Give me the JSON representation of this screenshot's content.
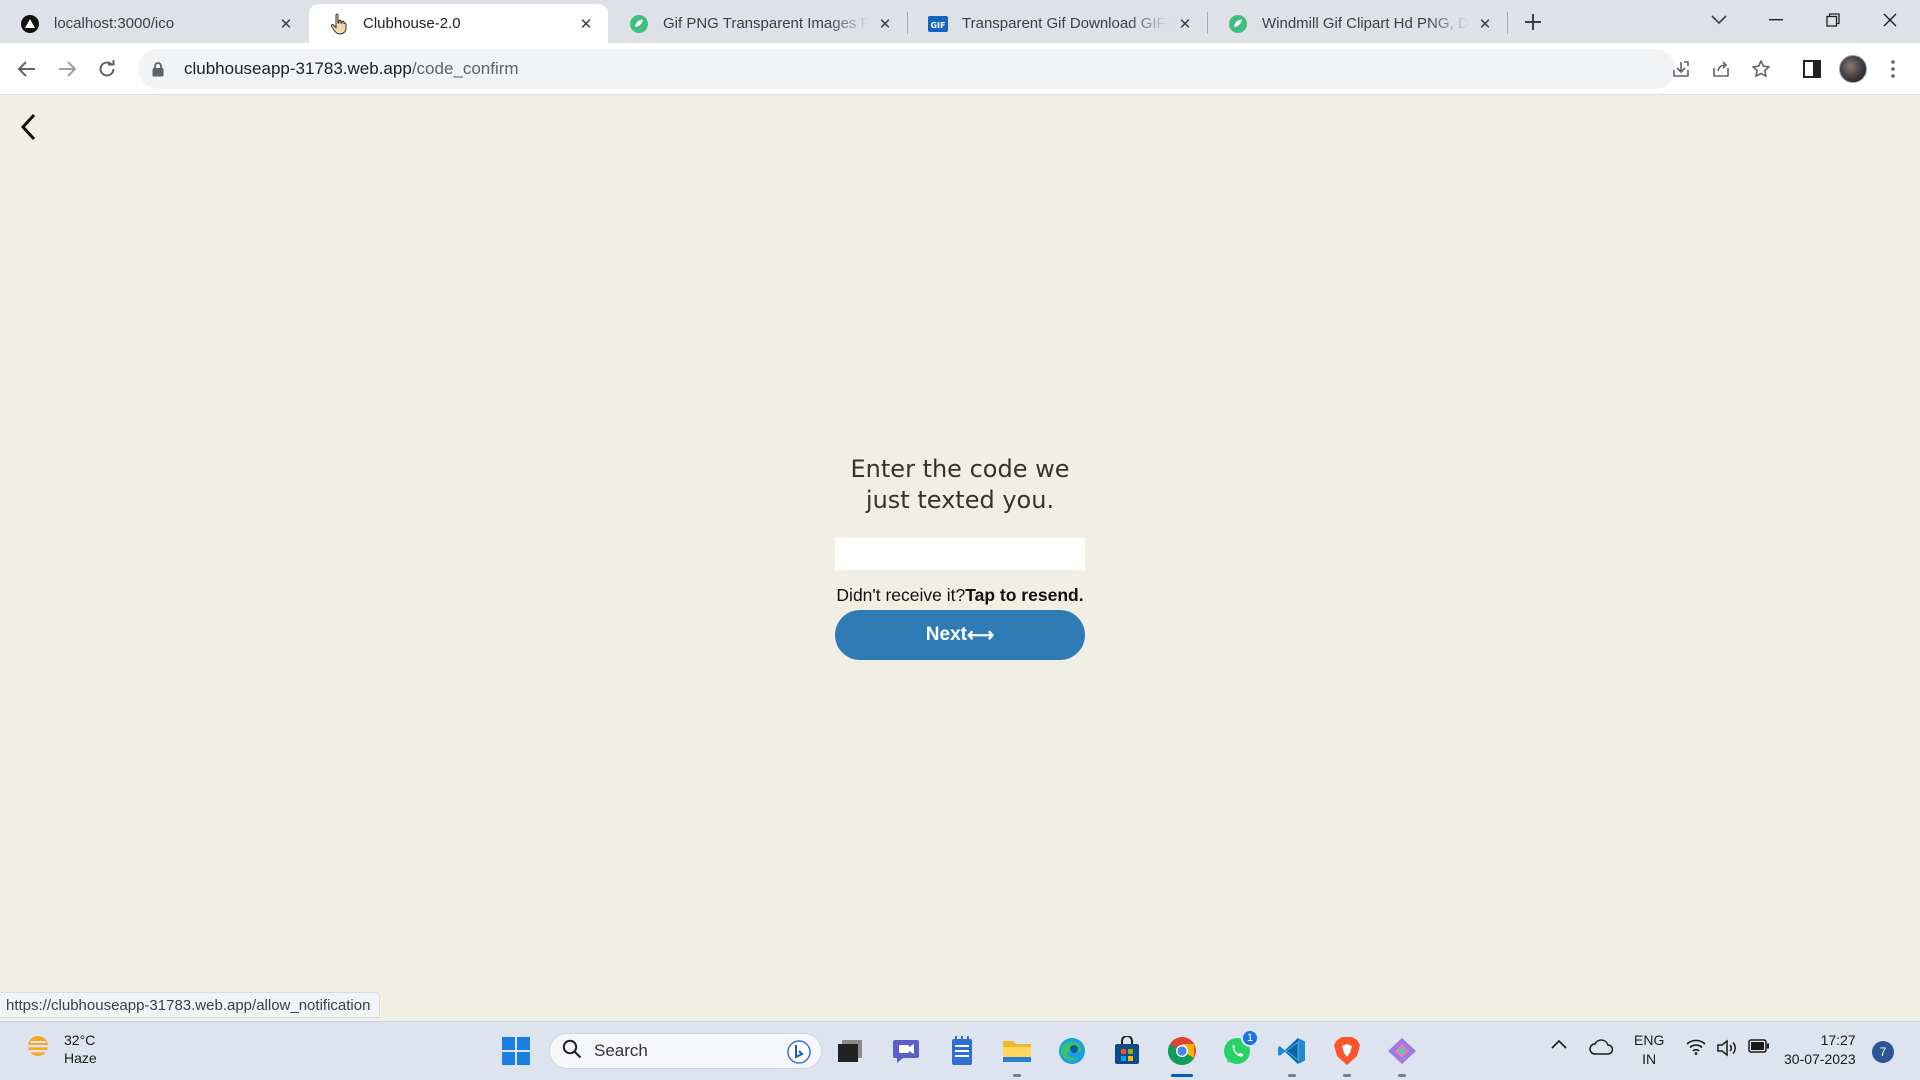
{
  "browser": {
    "tabs": [
      {
        "title": "localhost:3000/ico",
        "favicon": "react-app-icon",
        "active": false
      },
      {
        "title": "Clubhouse-2.0",
        "favicon": "pointer-hand-icon",
        "active": true
      },
      {
        "title": "Gif PNG Transparent Images Free",
        "favicon": "green-leaf-icon",
        "active": false
      },
      {
        "title": "Transparent Gif Download GIFs |",
        "favicon": "gif-icon",
        "active": false
      },
      {
        "title": "Windmill Gif Clipart Hd PNG, Dyn",
        "favicon": "green-leaf-icon",
        "active": false
      }
    ],
    "address": {
      "host": "clubhouseapp-31783.web.app",
      "path": "/code_confirm"
    },
    "status_url": "https://clubhouseapp-31783.web.app/allow_notification"
  },
  "page": {
    "heading": "Enter the code we just texted you.",
    "code_value": "",
    "resend_prefix": "Didn't receive it?",
    "resend_link": "Tap to resend.",
    "next_label": "Next",
    "next_arrow": "⟷"
  },
  "colors": {
    "page_bg": "#f1efe4",
    "accent": "#2f7bb6"
  },
  "taskbar": {
    "weather_temp": "32°C",
    "weather_desc": "Haze",
    "search_label": "Search",
    "whatsapp_badge": "1",
    "lang_line1": "ENG",
    "lang_line2": "IN",
    "time": "17:27",
    "date": "30-07-2023",
    "notification_count": "7"
  }
}
